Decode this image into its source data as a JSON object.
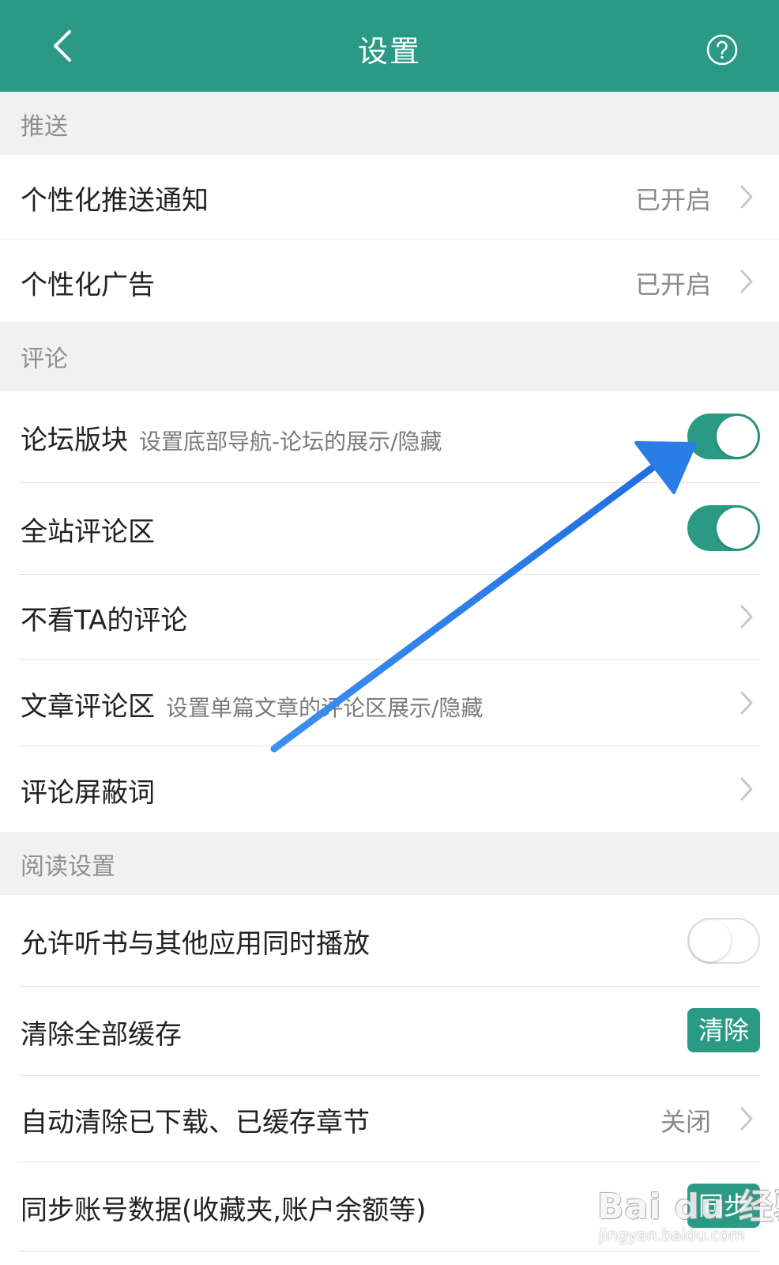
{
  "header": {
    "title": "设置",
    "back_icon": "chevron-left-icon",
    "help_icon": "question-circle-icon",
    "bg_color": "#2a9a84"
  },
  "sections": {
    "push": {
      "title": "推送"
    },
    "comment": {
      "title": "评论"
    },
    "reading": {
      "title": "阅读设置"
    }
  },
  "rows": {
    "personalized_push": {
      "label": "个性化推送通知",
      "value": "已开启"
    },
    "personalized_ads": {
      "label": "个性化广告",
      "value": "已开启"
    },
    "forum_section": {
      "label": "论坛版块",
      "sub": "设置底部导航-论坛的展示/隐藏",
      "toggle": "on"
    },
    "site_comments": {
      "label": "全站评论区",
      "toggle": "on"
    },
    "hide_ta_comments": {
      "label": "不看TA的评论"
    },
    "article_comments": {
      "label": "文章评论区",
      "sub": "设置单篇文章的评论区展示/隐藏"
    },
    "comment_block_words": {
      "label": "评论屏蔽词"
    },
    "allow_audio_mix": {
      "label": "允许听书与其他应用同时播放",
      "toggle": "off"
    },
    "clear_cache": {
      "label": "清除全部缓存",
      "button": "清除"
    },
    "auto_clear": {
      "label": "自动清除已下载、已缓存章节",
      "value": "关闭"
    },
    "sync_account": {
      "label": "同步账号数据(收藏夹,账户余额等)",
      "button": "同步"
    }
  },
  "watermark": {
    "brand": "Bai du 经验",
    "url": "jingyan.baidu.com"
  },
  "colors": {
    "accent": "#2a9a84",
    "annotation_arrow": "#2f7fe8"
  }
}
